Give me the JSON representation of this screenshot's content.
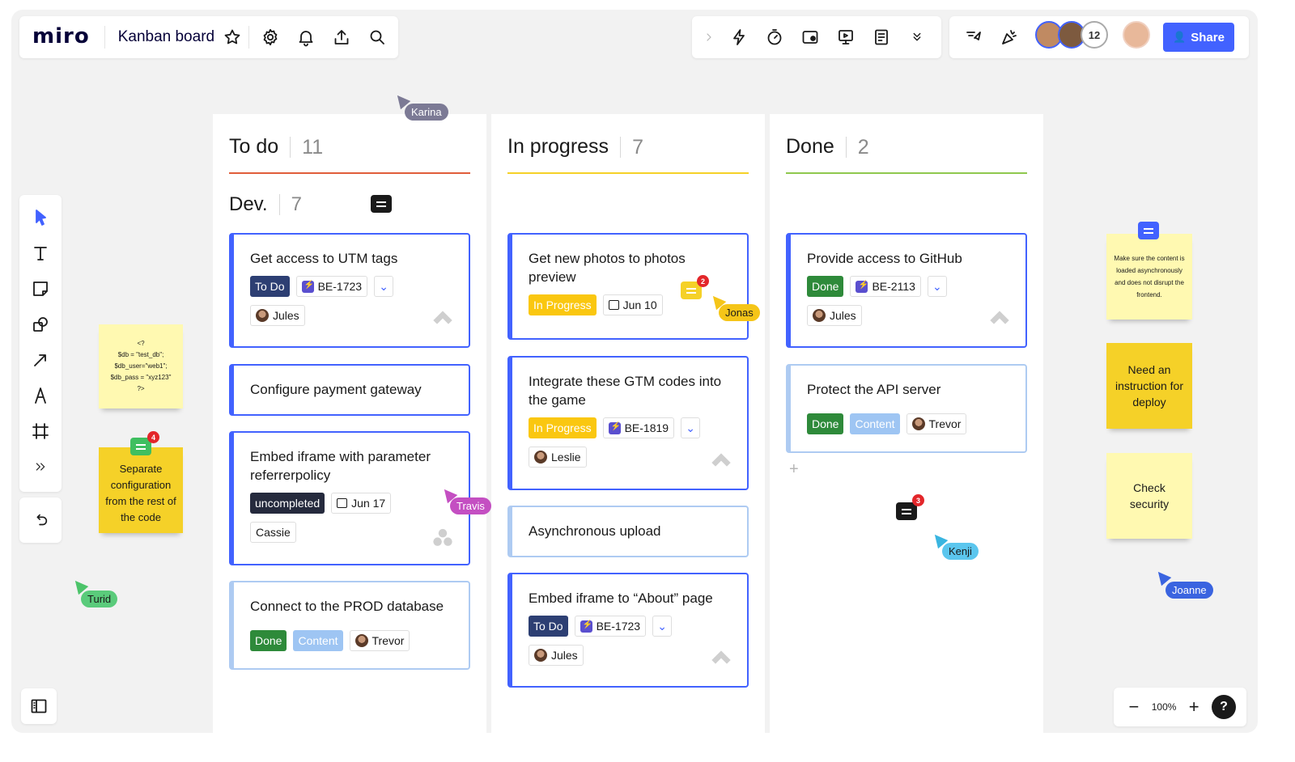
{
  "app": {
    "logo": "miro",
    "board_title": "Kanban board",
    "share_label": "Share",
    "collaborator_overflow": "12",
    "zoom_level": "100%",
    "help_label": "?"
  },
  "colors": {
    "accent": "#4262ff",
    "todo_line": "#e05d3a",
    "progress_line": "#f5d128",
    "done_line": "#8fc84e",
    "tag_todo": "#2d3f73",
    "tag_inprogress": "#fac710",
    "tag_done": "#2e8a3a",
    "tag_content": "#9ec5f3",
    "tag_uncompleted": "#252a3d"
  },
  "top_toolbar_icons": [
    "star-icon",
    "gear-icon",
    "bell-icon",
    "upload-icon",
    "search-icon"
  ],
  "right_toolbar_icons": [
    "chevron-right-icon",
    "lightning-icon",
    "timer-icon",
    "video-icon",
    "presentation-icon",
    "notes-icon",
    "chevron-double-down-icon"
  ],
  "collab_icons": [
    "cursor-follow-icon",
    "reactions-icon"
  ],
  "left_tools": [
    "select-icon",
    "text-icon",
    "sticky-note-icon",
    "shapes-icon",
    "arrow-icon",
    "pen-icon",
    "frame-icon",
    "more-tools-icon"
  ],
  "columns": {
    "todo": {
      "title": "To do",
      "count": "11",
      "subhead": "Dev.",
      "subcount": "7"
    },
    "progress": {
      "title": "In progress",
      "count": "7"
    },
    "done": {
      "title": "Done",
      "count": "2"
    }
  },
  "cards": {
    "c1": {
      "title": "Get access to UTM tags",
      "status": "To Do",
      "key": "BE-1723",
      "assignee": "Jules"
    },
    "c2": {
      "title": "Configure payment gateway"
    },
    "c3": {
      "title": "Embed iframe with parameter referrerpolicy",
      "status": "uncompleted",
      "date": "Jun 17",
      "assignee": "Cassie"
    },
    "c4": {
      "title": "Connect to the PROD database",
      "status": "Done",
      "label": "Content",
      "assignee": "Trevor"
    },
    "p1": {
      "title": "Get new photos to photos preview",
      "status": "In Progress",
      "date": "Jun 10",
      "comment_count": "2"
    },
    "p2": {
      "title": "Integrate these GTM codes into the game",
      "status": "In Progress",
      "key": "BE-1819",
      "assignee": "Leslie"
    },
    "p3": {
      "title": "Asynchronous upload"
    },
    "p4": {
      "title": "Embed iframe to “About” page",
      "status": "To Do",
      "key": "BE-1723",
      "assignee": "Jules"
    },
    "d1": {
      "title": "Provide access to GitHub",
      "status": "Done",
      "key": "BE-2113",
      "assignee": "Jules"
    },
    "d2": {
      "title": "Protect the API server",
      "status": "Done",
      "label": "Content",
      "assignee": "Trevor"
    }
  },
  "stickies": {
    "code": "<?\n$db = \"test_db\";\n$db_user=\"web1\";\n$db_pass = \"xyz123\"\n?>",
    "separate": "Separate configuration from the rest of the code",
    "separate_comments": "4",
    "async_note": "Make sure the content is loaded asynchronously and does not disrupt the frontend.",
    "deploy": "Need an instruction for deploy",
    "security": "Check security"
  },
  "done_comment_count": "3",
  "cursors": {
    "karina": "Karina",
    "jonas": "Jonas",
    "travis": "Travis",
    "turid": "Turid",
    "kenji": "Kenji",
    "joanne": "Joanne"
  }
}
